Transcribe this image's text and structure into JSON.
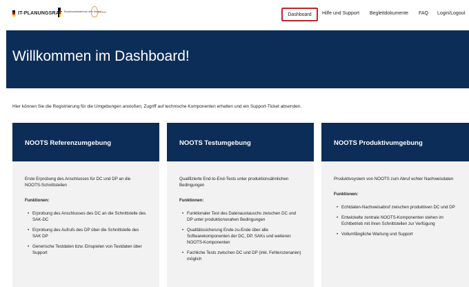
{
  "header": {
    "logo_main": "IT-PLANUNGSRAT",
    "logo_bmi": "Bundesministerium des Innern",
    "logo_fitko": "FITKO",
    "nav": {
      "dashboard": "Dashboard",
      "hilfe": "Hilfe und Support",
      "begleit": "Begleitdokumente",
      "faq": "FAQ",
      "login": "Login/Logout"
    },
    "active_highlight_color": "#c0232c"
  },
  "hero": {
    "title": "Willkommen im Dashboard!",
    "bg_color": "#0c2d57"
  },
  "intro": "Hier können Sie die Registrierung für die Umgebungen anstoßen, Zugriff auf technische Komponenten erhalten und ein Support-Ticket absenden.",
  "cards": [
    {
      "title": "NOOTS Referenzumgebung",
      "description": "Erste Erprobung des Anschlusses für DC und DP an die NOOTS-Schnittstellen",
      "functions_label": "Funktionen:",
      "functions": [
        "Erprobung des Anschlusses des DC an die Schnittstelle des SAK-DC",
        "Erprobung des Aufrufs des DP über die Schnittstelle des SAK DP",
        "Generische Testdaten bzw. Einspielen von Testdaten über Support"
      ]
    },
    {
      "title": "NOOTS Testumgebung",
      "description": "Qualifizierte End-to-End-Tests unter produktionsähnlichen Bedingungen",
      "functions_label": "Funktionen:",
      "functions": [
        "Funktionaler Test des Datenaustauschs zwischen DC und DP unter produktionsnahen Bedingungen",
        "Qualitätssicherung Ende-zu-Ende über alle Softwarekomponenten der DC, DP, SAKs und weiteren NOOTS-Komponenten",
        "Fachliche Tests zwischen DC und DP (inkl. Fehlerszenarien) möglich"
      ]
    },
    {
      "title": "NOOTS Produktivumgebung",
      "description": "Produktivsystem von NOOTS zum Abruf echter Nachweisdaten",
      "functions_label": "Funktionen:",
      "functions": [
        "Echtdaten-Nachweisabruf zwischen produktiven DC und DP",
        "Entwickelte zentrale NOOTS-Komponenten stehen im Echtbetrieb mit ihren Schnittstellen zur Verfügung",
        "Vollumfängliche Wartung und Support"
      ]
    }
  ]
}
